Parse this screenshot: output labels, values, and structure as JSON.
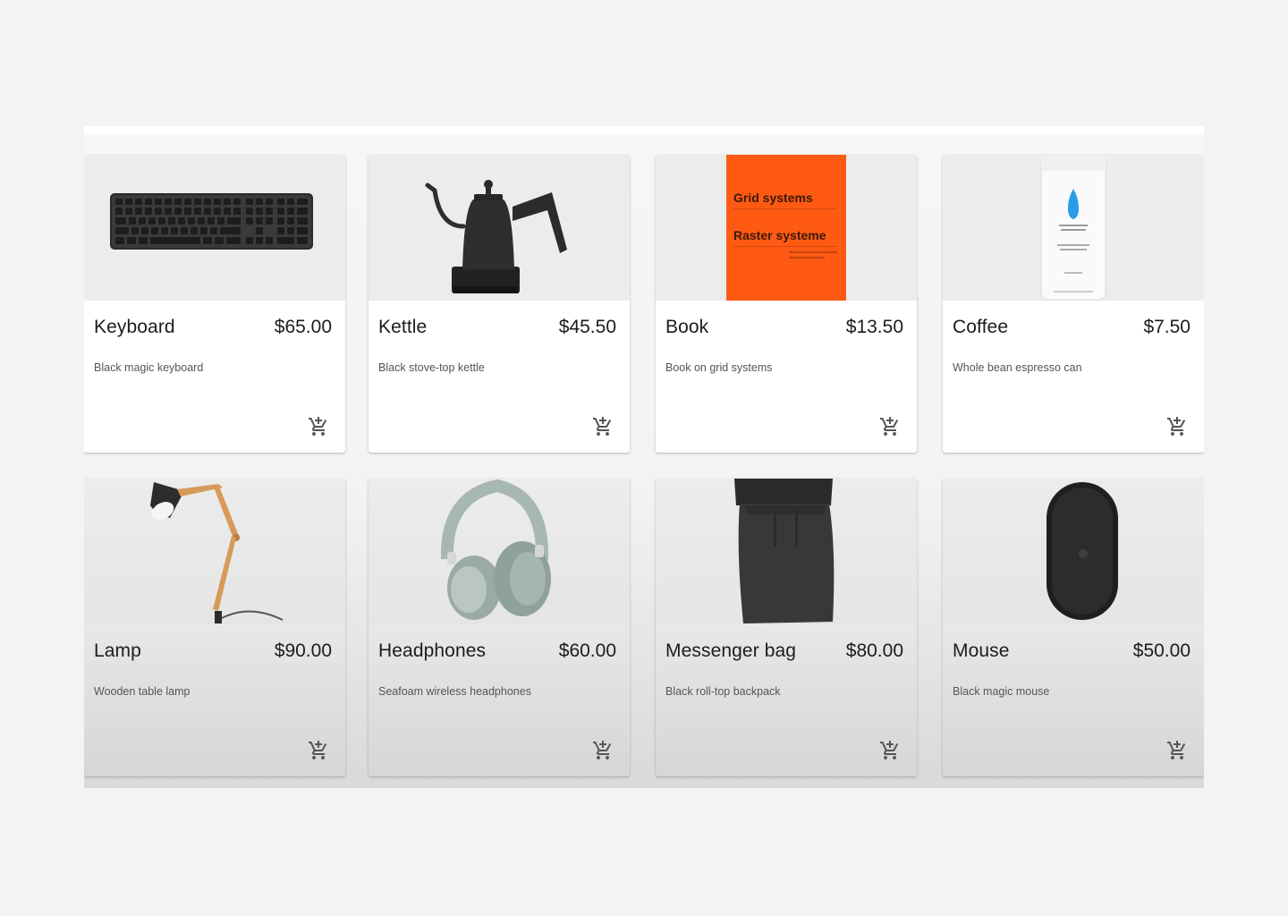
{
  "products": [
    {
      "name": "Keyboard",
      "price": "$65.00",
      "description": "Black magic keyboard",
      "image_icon": "keyboard-image"
    },
    {
      "name": "Kettle",
      "price": "$45.50",
      "description": "Black stove-top kettle",
      "image_icon": "kettle-image"
    },
    {
      "name": "Book",
      "price": "$13.50",
      "description": "Book on grid systems",
      "image_icon": "book-image",
      "cover_title": "Grid systems",
      "cover_subtitle": "Raster systeme"
    },
    {
      "name": "Coffee",
      "price": "$7.50",
      "description": "Whole bean espresso can",
      "image_icon": "coffee-can-image"
    },
    {
      "name": "Lamp",
      "price": "$90.00",
      "description": "Wooden table lamp",
      "image_icon": "lamp-image"
    },
    {
      "name": "Headphones",
      "price": "$60.00",
      "description": "Seafoam wireless headphones",
      "image_icon": "headphones-image"
    },
    {
      "name": "Messenger bag",
      "price": "$80.00",
      "description": "Black roll-top backpack",
      "image_icon": "backpack-image"
    },
    {
      "name": "Mouse",
      "price": "$50.00",
      "description": "Black magic mouse",
      "image_icon": "mouse-image"
    }
  ],
  "actions": {
    "add_to_cart_icon": "add-shopping-cart-icon"
  },
  "colors": {
    "book_cover": "#ff5a14",
    "coffee_logo": "#2a9be8",
    "headphones": "#9aaba6",
    "lamp_wood": "#d79a5a",
    "page_background": "#f2f3f5"
  }
}
